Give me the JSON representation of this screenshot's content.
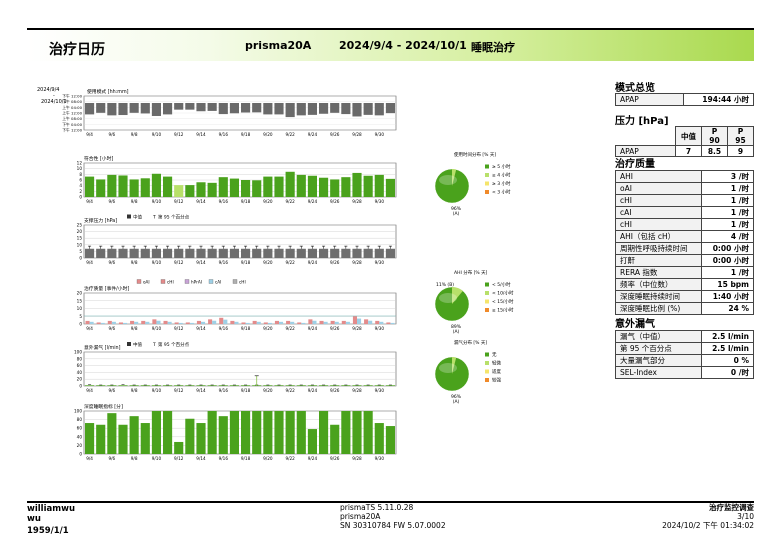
{
  "header": {
    "title": "治疗日历",
    "device": "prisma20A",
    "range": "2024/9/4 - 2024/10/1",
    "mode": "睡眠治疗"
  },
  "usage_panel": {
    "title": "使用模式 [hh:mm]",
    "date_top": "2024/9/4",
    "date_dash": "-",
    "date_bottom": "2024/10/1",
    "time_ticks": [
      "下午 12:00",
      "下午 08:00",
      "上午 04:00",
      "上午 12:00",
      "上午 08:00",
      "下午 04:00",
      "下午 12:00"
    ]
  },
  "x_ticks": [
    "9/4",
    "9/6",
    "9/8",
    "9/10",
    "9/12",
    "9/14",
    "9/16",
    "9/18",
    "9/20",
    "9/22",
    "9/24",
    "9/26",
    "9/28",
    "9/30"
  ],
  "charts": {
    "compliance": {
      "title": "符合性 [小时]",
      "y_ticks": [
        "12",
        "10",
        "8",
        "6",
        "4",
        "2",
        "0"
      ],
      "values": [
        7.2,
        6.2,
        7.8,
        7.6,
        6.2,
        6.6,
        8.2,
        7.2,
        4.2,
        4.2,
        5.2,
        5.0,
        7.0,
        6.5,
        6.0,
        5.9,
        7.2,
        7.2,
        8.9,
        7.8,
        7.5,
        6.8,
        6.2,
        7.0,
        8.5,
        7.5,
        7.8,
        6.4
      ],
      "light_days": [
        8
      ]
    },
    "pressure": {
      "title": "支撑压力 [hPa]",
      "legend_median": "中值",
      "legend_p95": "第 95 个百分点",
      "y_ticks": [
        "25",
        "20",
        "15",
        "10",
        "5",
        "0"
      ],
      "median": [
        7,
        7,
        7,
        7,
        7,
        7,
        7,
        7,
        7,
        7,
        7,
        7,
        7,
        7,
        7,
        7,
        7,
        7,
        7,
        7,
        7,
        7,
        7,
        7,
        7,
        7,
        7,
        7
      ],
      "p95": [
        9,
        9,
        9,
        9,
        9,
        9,
        9,
        9,
        9,
        9,
        9,
        9,
        9,
        9,
        9,
        9,
        9,
        9,
        9,
        9,
        9,
        9,
        9,
        9,
        9,
        9,
        9,
        9
      ]
    },
    "events": {
      "title": "治疗质量 [事件/小时]",
      "legend": [
        "oAI",
        "cHI",
        "hPrAI",
        "cAI",
        "cHI"
      ],
      "y_ticks": [
        "20",
        "15",
        "10",
        "5",
        "0"
      ],
      "values": [
        2,
        1,
        2,
        1,
        2,
        2,
        3,
        2,
        1,
        1,
        2,
        3,
        4,
        2,
        1,
        2,
        1,
        2,
        2,
        1,
        3,
        2,
        2,
        2,
        5,
        3,
        2,
        1
      ]
    },
    "leak": {
      "title": "意外漏气 [l/min]",
      "legend_median": "中值",
      "legend_p95": "第 95 个百分点",
      "y_ticks": [
        "100",
        "80",
        "60",
        "40",
        "20",
        "0"
      ],
      "median": [
        2,
        2,
        2,
        2,
        2,
        2,
        2,
        2,
        2,
        2,
        2,
        2,
        2,
        2,
        2,
        2,
        2,
        2,
        2,
        2,
        2,
        2,
        2,
        2,
        2,
        2,
        2,
        2
      ],
      "p95": [
        4,
        3,
        3,
        4,
        3,
        3,
        3,
        3,
        3,
        3,
        3,
        3,
        3,
        3,
        3,
        3,
        3,
        3,
        3,
        3,
        3,
        3,
        3,
        3,
        3,
        3,
        3,
        3
      ],
      "spike_day": 15,
      "spike_value": 30
    },
    "deep_sleep": {
      "title": "深度睡眠指标 [分]",
      "y_ticks": [
        "100",
        "80",
        "60",
        "40",
        "20",
        "0"
      ],
      "values": [
        72,
        68,
        95,
        68,
        88,
        72,
        100,
        100,
        28,
        82,
        72,
        100,
        88,
        100,
        100,
        100,
        100,
        100,
        100,
        100,
        58,
        100,
        68,
        100,
        100,
        100,
        72,
        65
      ]
    }
  },
  "pies": [
    {
      "title": "使用时间分布 [% 天]",
      "label_left": "",
      "label_bottom": "96%",
      "label_bottom2": "(A)",
      "fraction": 0.96,
      "legend": [
        "≥ 5 小时",
        "≥ 4 小时",
        "≥ 3 小时",
        "< 3 小时"
      ],
      "colors": [
        "#4aa21c",
        "#b8e06a",
        "#f5e56b",
        "#f08a2a"
      ]
    },
    {
      "title": "AHI 分布 [% 天]",
      "label_left": "11% (B)",
      "label_bottom": "89%",
      "label_bottom2": "(A)",
      "fraction": 0.89,
      "legend": [
        "< 5/小时",
        "< 10/小时",
        "< 15/小时",
        "≥ 15/小时"
      ],
      "colors": [
        "#4aa21c",
        "#b8e06a",
        "#f5e56b",
        "#f08a2a"
      ]
    },
    {
      "title": "漏气分布 [% 天]",
      "label_left": "",
      "label_bottom": "96%",
      "label_bottom2": "(A)",
      "fraction": 0.96,
      "legend": [
        "无",
        "轻微",
        "适度",
        "较强"
      ],
      "colors": [
        "#4aa21c",
        "#b8e06a",
        "#f5e56b",
        "#f08a2a"
      ]
    }
  ],
  "sidebar": {
    "overview_title": "模式总览",
    "overview": {
      "label": "APAP",
      "value": "194:44 小时"
    },
    "pressure_title": "压力 [hPa]",
    "pressure_head": [
      "中值",
      "P 90",
      "P 95"
    ],
    "pressure_row": {
      "label": "APAP",
      "median": "7",
      "p90": "8.5",
      "p95": "9"
    },
    "quality_title": "治疗质量",
    "quality": [
      {
        "label": "AHI",
        "value": "3 /时"
      },
      {
        "label": "oAI",
        "value": "1 /时"
      },
      {
        "label": "cHI",
        "value": "1 /时"
      },
      {
        "label": "cAI",
        "value": "1 /时"
      },
      {
        "label": "cHI",
        "value": "1 /时"
      },
      {
        "label": "AHI（包括 cH）",
        "value": "4 /时"
      },
      {
        "label": "周期性呼吸持续时间",
        "value": "0:00 小时"
      },
      {
        "label": "打鼾",
        "value": "0:00 小时"
      },
      {
        "label": "RERA 指数",
        "value": "1 /时"
      },
      {
        "label": "频率（中位数）",
        "value": "15 bpm"
      },
      {
        "label": "深度睡眠持续时间",
        "value": "1:40 小时"
      },
      {
        "label": "深度睡眠比例 (%)",
        "value": "24 %"
      }
    ],
    "leak_title": "意外漏气",
    "leak": [
      {
        "label": "漏气（中值）",
        "value": "2.5 l/min"
      },
      {
        "label": "第 95 个百分点",
        "value": "2.5 l/min"
      },
      {
        "label": "大量漏气部分",
        "value": "0 %"
      },
      {
        "label": "SEL-Index",
        "value": "0 /时"
      }
    ]
  },
  "footer": {
    "patient_name1": "williamwu",
    "patient_name2": "wu",
    "dob": "1959/1/1",
    "software": "prismaTS 5.11.0.28",
    "device": "prisma20A",
    "serial": "SN 30310784 FW 5.07.0002",
    "report_type": "治疗监控调查",
    "page": "3/10",
    "printed": "2024/10/2 下午 01:34:02"
  },
  "colors": {
    "bar_green": "#4aa21c",
    "bar_light": "#b8e06a",
    "pressure_gray": "#6e6e6e",
    "usage_gray": "#6a6a6a",
    "header_green": "#a9d94e"
  }
}
